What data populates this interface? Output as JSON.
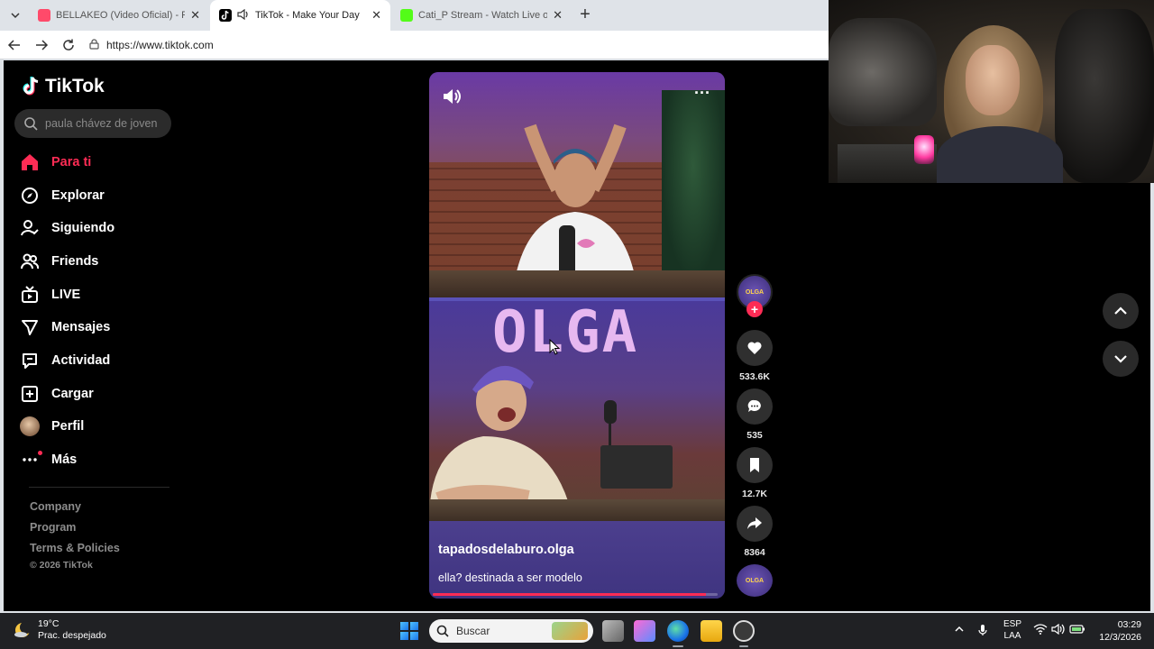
{
  "browser": {
    "tabs": [
      {
        "title": "BELLAKEO (Video Oficial) - Peso P",
        "active": false
      },
      {
        "title": "TikTok - Make Your Day",
        "active": true
      },
      {
        "title": "Cati_P Stream - Watch Live on Kick",
        "active": false
      }
    ],
    "url": "https://www.tiktok.com"
  },
  "tiktok": {
    "brand": "TikTok",
    "search_placeholder": "paula chávez de joven",
    "nav": [
      {
        "label": "Para ti",
        "icon": "home-icon",
        "active": true
      },
      {
        "label": "Explorar",
        "icon": "compass-icon",
        "active": false
      },
      {
        "label": "Siguiendo",
        "icon": "following-icon",
        "active": false
      },
      {
        "label": "Friends",
        "icon": "friends-icon",
        "active": false
      },
      {
        "label": "LIVE",
        "icon": "live-icon",
        "active": false
      },
      {
        "label": "Mensajes",
        "icon": "messages-icon",
        "active": false
      },
      {
        "label": "Actividad",
        "icon": "activity-icon",
        "active": false
      },
      {
        "label": "Cargar",
        "icon": "upload-icon",
        "active": false
      },
      {
        "label": "Perfil",
        "icon": "profile-avatar",
        "active": false
      },
      {
        "label": "Más",
        "icon": "more-icon",
        "active": false
      }
    ],
    "footer": {
      "company": "Company",
      "program": "Program",
      "terms": "Terms & Policies",
      "copyright": "© 2026 TikTok"
    },
    "video": {
      "overlay_text": "OLGA",
      "author": "tapadosdelaburo.olga",
      "description": "ella? destinada a ser modelo",
      "progress": 0.96
    },
    "actions": {
      "likes": "533.6K",
      "comments": "535",
      "saves": "12.7K",
      "shares": "8364"
    },
    "accent_color": "#fe2c55"
  },
  "taskbar": {
    "temperature": "19°C",
    "weather": "Prac. despejado",
    "search_placeholder": "Buscar",
    "language_top": "ESP",
    "language_bottom": "LAA",
    "time": "03:29",
    "date": "12/3/2026"
  }
}
